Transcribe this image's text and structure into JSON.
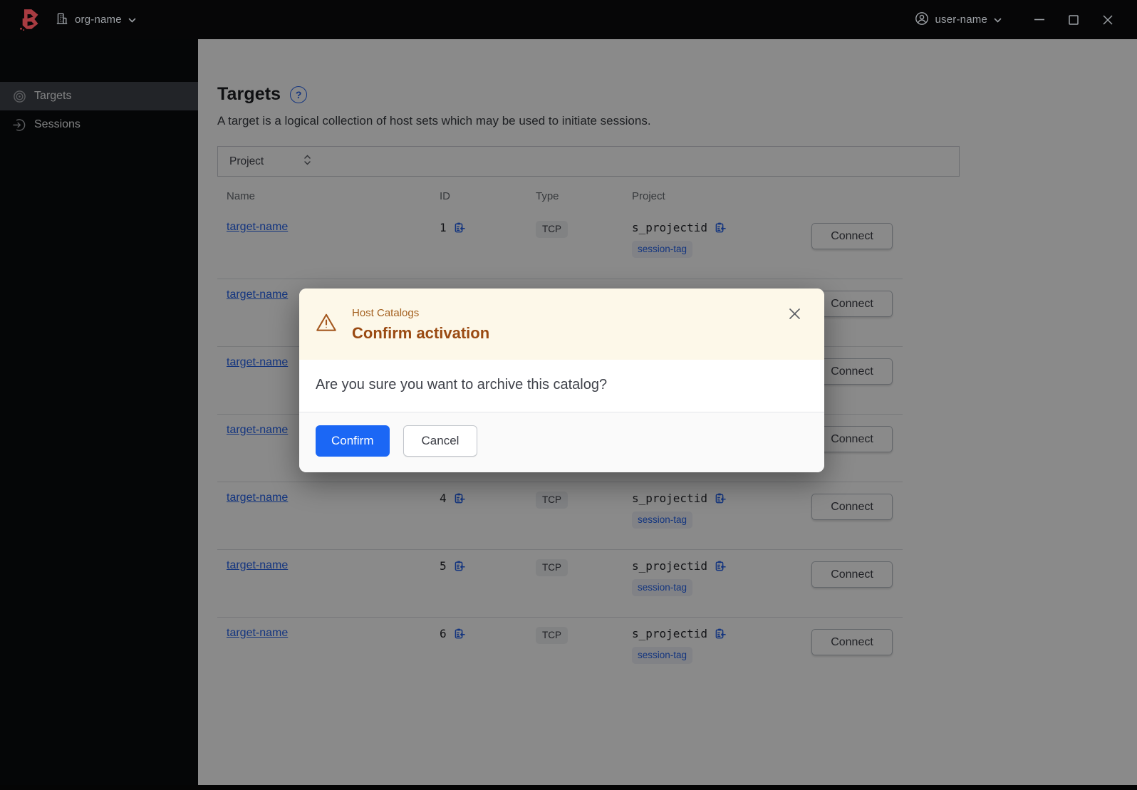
{
  "topbar": {
    "org_name": "org-name",
    "user_name": "user-name"
  },
  "sidebar": {
    "items": [
      {
        "label": "Targets",
        "icon": "target-icon",
        "active": true
      },
      {
        "label": "Sessions",
        "icon": "session-entry-icon",
        "active": false
      }
    ]
  },
  "page": {
    "title": "Targets",
    "description": "A target is a logical collection of host sets which may be used to initiate sessions.",
    "filter_label": "Project",
    "table": {
      "columns": [
        "Name",
        "ID",
        "Type",
        "Project"
      ],
      "connect_label": "Connect",
      "rows": [
        {
          "name": "target-name",
          "id": "1",
          "type": "TCP",
          "project": "s_projectid",
          "tag": "session-tag"
        },
        {
          "name": "target-name",
          "id": "",
          "type": "",
          "project": "",
          "tag": ""
        },
        {
          "name": "target-name",
          "id": "",
          "type": "",
          "project": "",
          "tag": ""
        },
        {
          "name": "target-name",
          "id": "",
          "type": "",
          "project": "",
          "tag": ""
        },
        {
          "name": "target-name",
          "id": "4",
          "type": "TCP",
          "project": "s_projectid",
          "tag": "session-tag"
        },
        {
          "name": "target-name",
          "id": "5",
          "type": "TCP",
          "project": "s_projectid",
          "tag": "session-tag"
        },
        {
          "name": "target-name",
          "id": "6",
          "type": "TCP",
          "project": "s_projectid",
          "tag": "session-tag"
        }
      ]
    }
  },
  "modal": {
    "context": "Host Catalogs",
    "title": "Confirm activation",
    "body": "Are you sure you want to archive this catalog?",
    "confirm_label": "Confirm",
    "cancel_label": "Cancel"
  },
  "colors": {
    "accent_blue": "#1b67f5",
    "link_blue": "#2563eb",
    "warning_title": "#9a4a12",
    "warning_surface": "#fdf8e9",
    "logo_red": "#a83b41",
    "topbar_bg": "#060607"
  }
}
